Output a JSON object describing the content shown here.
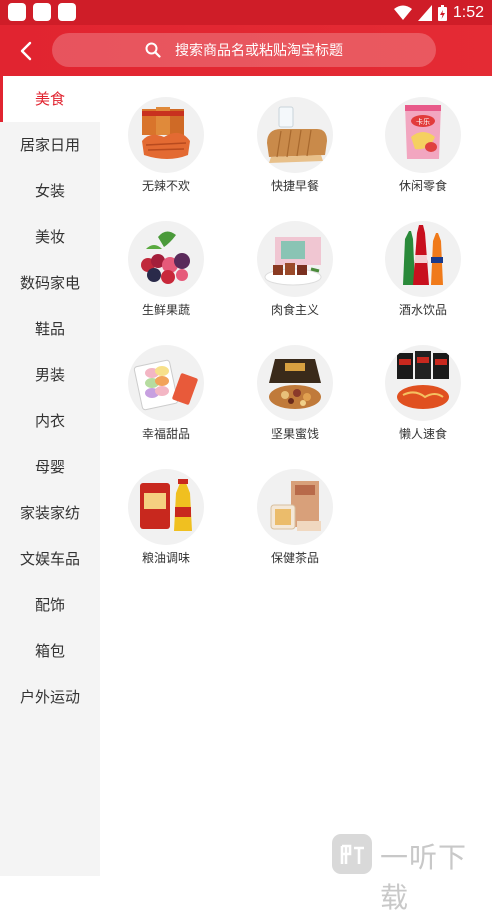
{
  "status_bar": {
    "time": "1:52"
  },
  "header": {
    "back_icon": "chevron-left-icon",
    "search_placeholder": "搜索商品名或粘贴淘宝标题",
    "search_icon": "search-icon"
  },
  "sidebar": {
    "items": [
      {
        "label": "美食",
        "active": true
      },
      {
        "label": "居家日用"
      },
      {
        "label": "女装"
      },
      {
        "label": "美妆"
      },
      {
        "label": "数码家电"
      },
      {
        "label": "鞋品"
      },
      {
        "label": "男装"
      },
      {
        "label": "内衣"
      },
      {
        "label": "母婴"
      },
      {
        "label": "家装家纺"
      },
      {
        "label": "文娱车品"
      },
      {
        "label": "配饰"
      },
      {
        "label": "箱包"
      },
      {
        "label": "户外运动"
      }
    ]
  },
  "categories": [
    {
      "label": "无辣不欢",
      "icon": "spicy-snack-icon"
    },
    {
      "label": "快捷早餐",
      "icon": "bread-icon"
    },
    {
      "label": "休闲零食",
      "icon": "chips-bag-icon"
    },
    {
      "label": "生鲜果蔬",
      "icon": "berries-icon"
    },
    {
      "label": "肉食主义",
      "icon": "meat-box-icon"
    },
    {
      "label": "酒水饮品",
      "icon": "bottles-icon"
    },
    {
      "label": "幸福甜品",
      "icon": "macaron-icon"
    },
    {
      "label": "坚果蜜饯",
      "icon": "nuts-icon"
    },
    {
      "label": "懒人速食",
      "icon": "instant-noodle-icon"
    },
    {
      "label": "粮油调味",
      "icon": "rice-oil-icon"
    },
    {
      "label": "保健茶品",
      "icon": "tea-box-icon"
    }
  ],
  "watermark": {
    "text": "一听下载"
  },
  "colors": {
    "brand_red": "#e12430",
    "sidebar_bg": "#f4f4f4"
  }
}
